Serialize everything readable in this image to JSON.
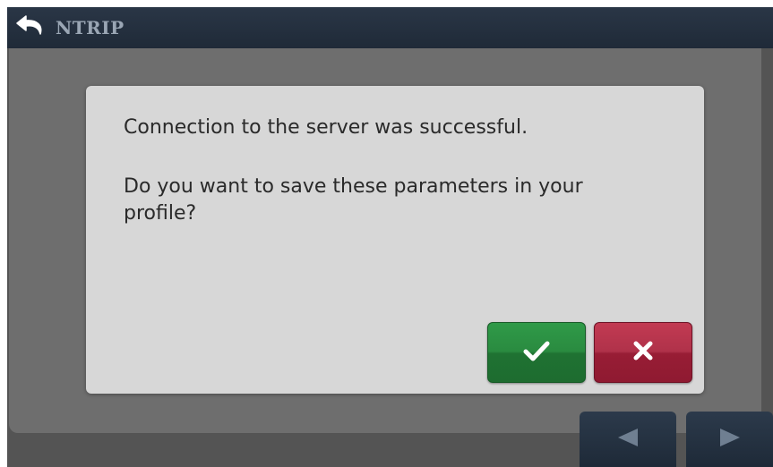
{
  "header": {
    "title": "NTRIP",
    "back_icon": "back-arrow-icon"
  },
  "dialog": {
    "message_line1": "Connection to the server was successful.",
    "message_line2": "Do you want to save these parameters in your profile?",
    "confirm_icon": "checkmark-icon",
    "cancel_icon": "close-icon"
  },
  "navigation": {
    "prev_icon": "triangle-left-icon",
    "next_icon": "triangle-right-icon"
  },
  "colors": {
    "header_bg": "#1f2a38",
    "dialog_bg": "#d7d7d7",
    "confirm_green": "#2a8b40",
    "cancel_red": "#a42a42",
    "nav_bg": "#1e2a38"
  }
}
